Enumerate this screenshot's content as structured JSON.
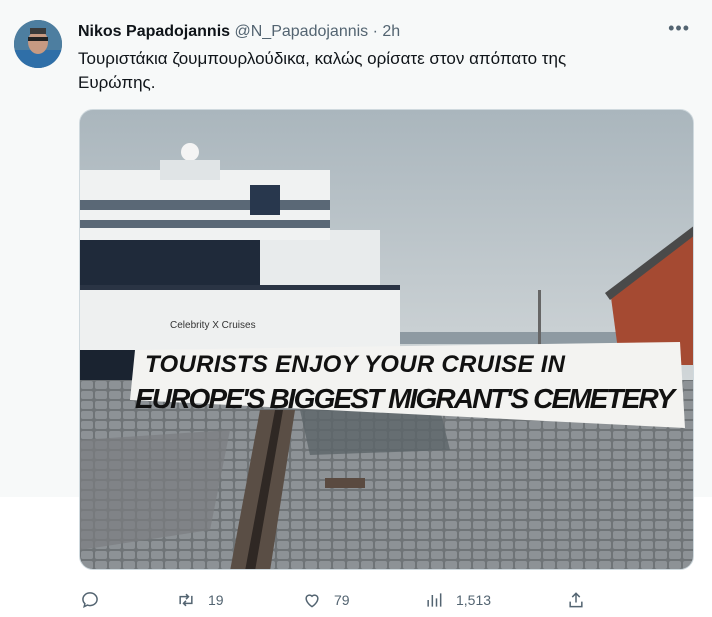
{
  "tweet": {
    "author_name": "Nikos Papadojannis",
    "handle": "@N_Papadojannis",
    "separator": "·",
    "time": "2h",
    "more_label": "•••",
    "text": "Τουριστάκια ζουμπουρλούδικα, καλώς ορίσατε στον απόπατο της Ευρώπης.",
    "media": {
      "banner_line1": "TOURISTS ENJOY YOUR CRUISE IN",
      "banner_line2": "EUROPE'S BIGGEST MIGRANT'S CEMETERY",
      "ship_text": "Celebrity X Cruises"
    },
    "actions": {
      "reply_icon": "reply-icon",
      "retweet_icon": "retweet-icon",
      "like_icon": "like-icon",
      "views_icon": "views-icon",
      "share_icon": "share-icon",
      "retweets": "19",
      "likes": "79",
      "views": "1,513"
    }
  }
}
